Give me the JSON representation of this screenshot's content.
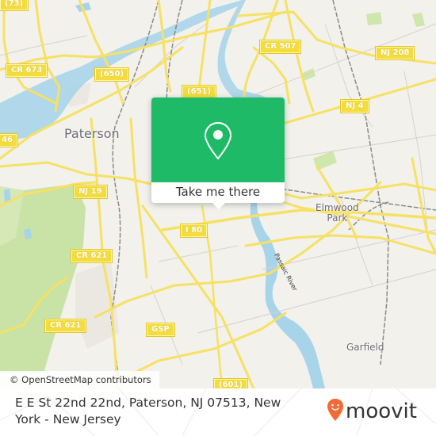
{
  "map": {
    "road_shields": [
      {
        "label": "(73)"
      },
      {
        "label": "CR 673"
      },
      {
        "label": "(650)"
      },
      {
        "label": "(651)"
      },
      {
        "label": "CR 507"
      },
      {
        "label": "NJ 208"
      },
      {
        "label": "NJ 4"
      },
      {
        "label": "46"
      },
      {
        "label": "NJ 19"
      },
      {
        "label": "I 80"
      },
      {
        "label": "CR 621"
      },
      {
        "label": "CR 621"
      },
      {
        "label": "GSP"
      },
      {
        "label": "(601)"
      }
    ],
    "places": {
      "paterson": "Paterson",
      "elmwood_park_line1": "Elmwood",
      "elmwood_park_line2": "Park",
      "garfield": "Garfield"
    },
    "water_labels": {
      "passaic_river": "Passaic River"
    },
    "attribution": "© OpenStreetMap contributors",
    "colors": {
      "land": "#f2f1ec",
      "road": "#f6e164",
      "water": "#a8d4ea",
      "park": "#c9e2a6"
    }
  },
  "popup": {
    "icon": "location-pin-icon",
    "button_label": "Take me there",
    "accent_color": "#1fba67"
  },
  "footer": {
    "address": "E E St 22nd 22nd, Paterson, NJ 07513, New York - New Jersey",
    "brand": "moovit",
    "brand_icon": "moovit-pin-icon",
    "brand_color": "#f26a36"
  }
}
